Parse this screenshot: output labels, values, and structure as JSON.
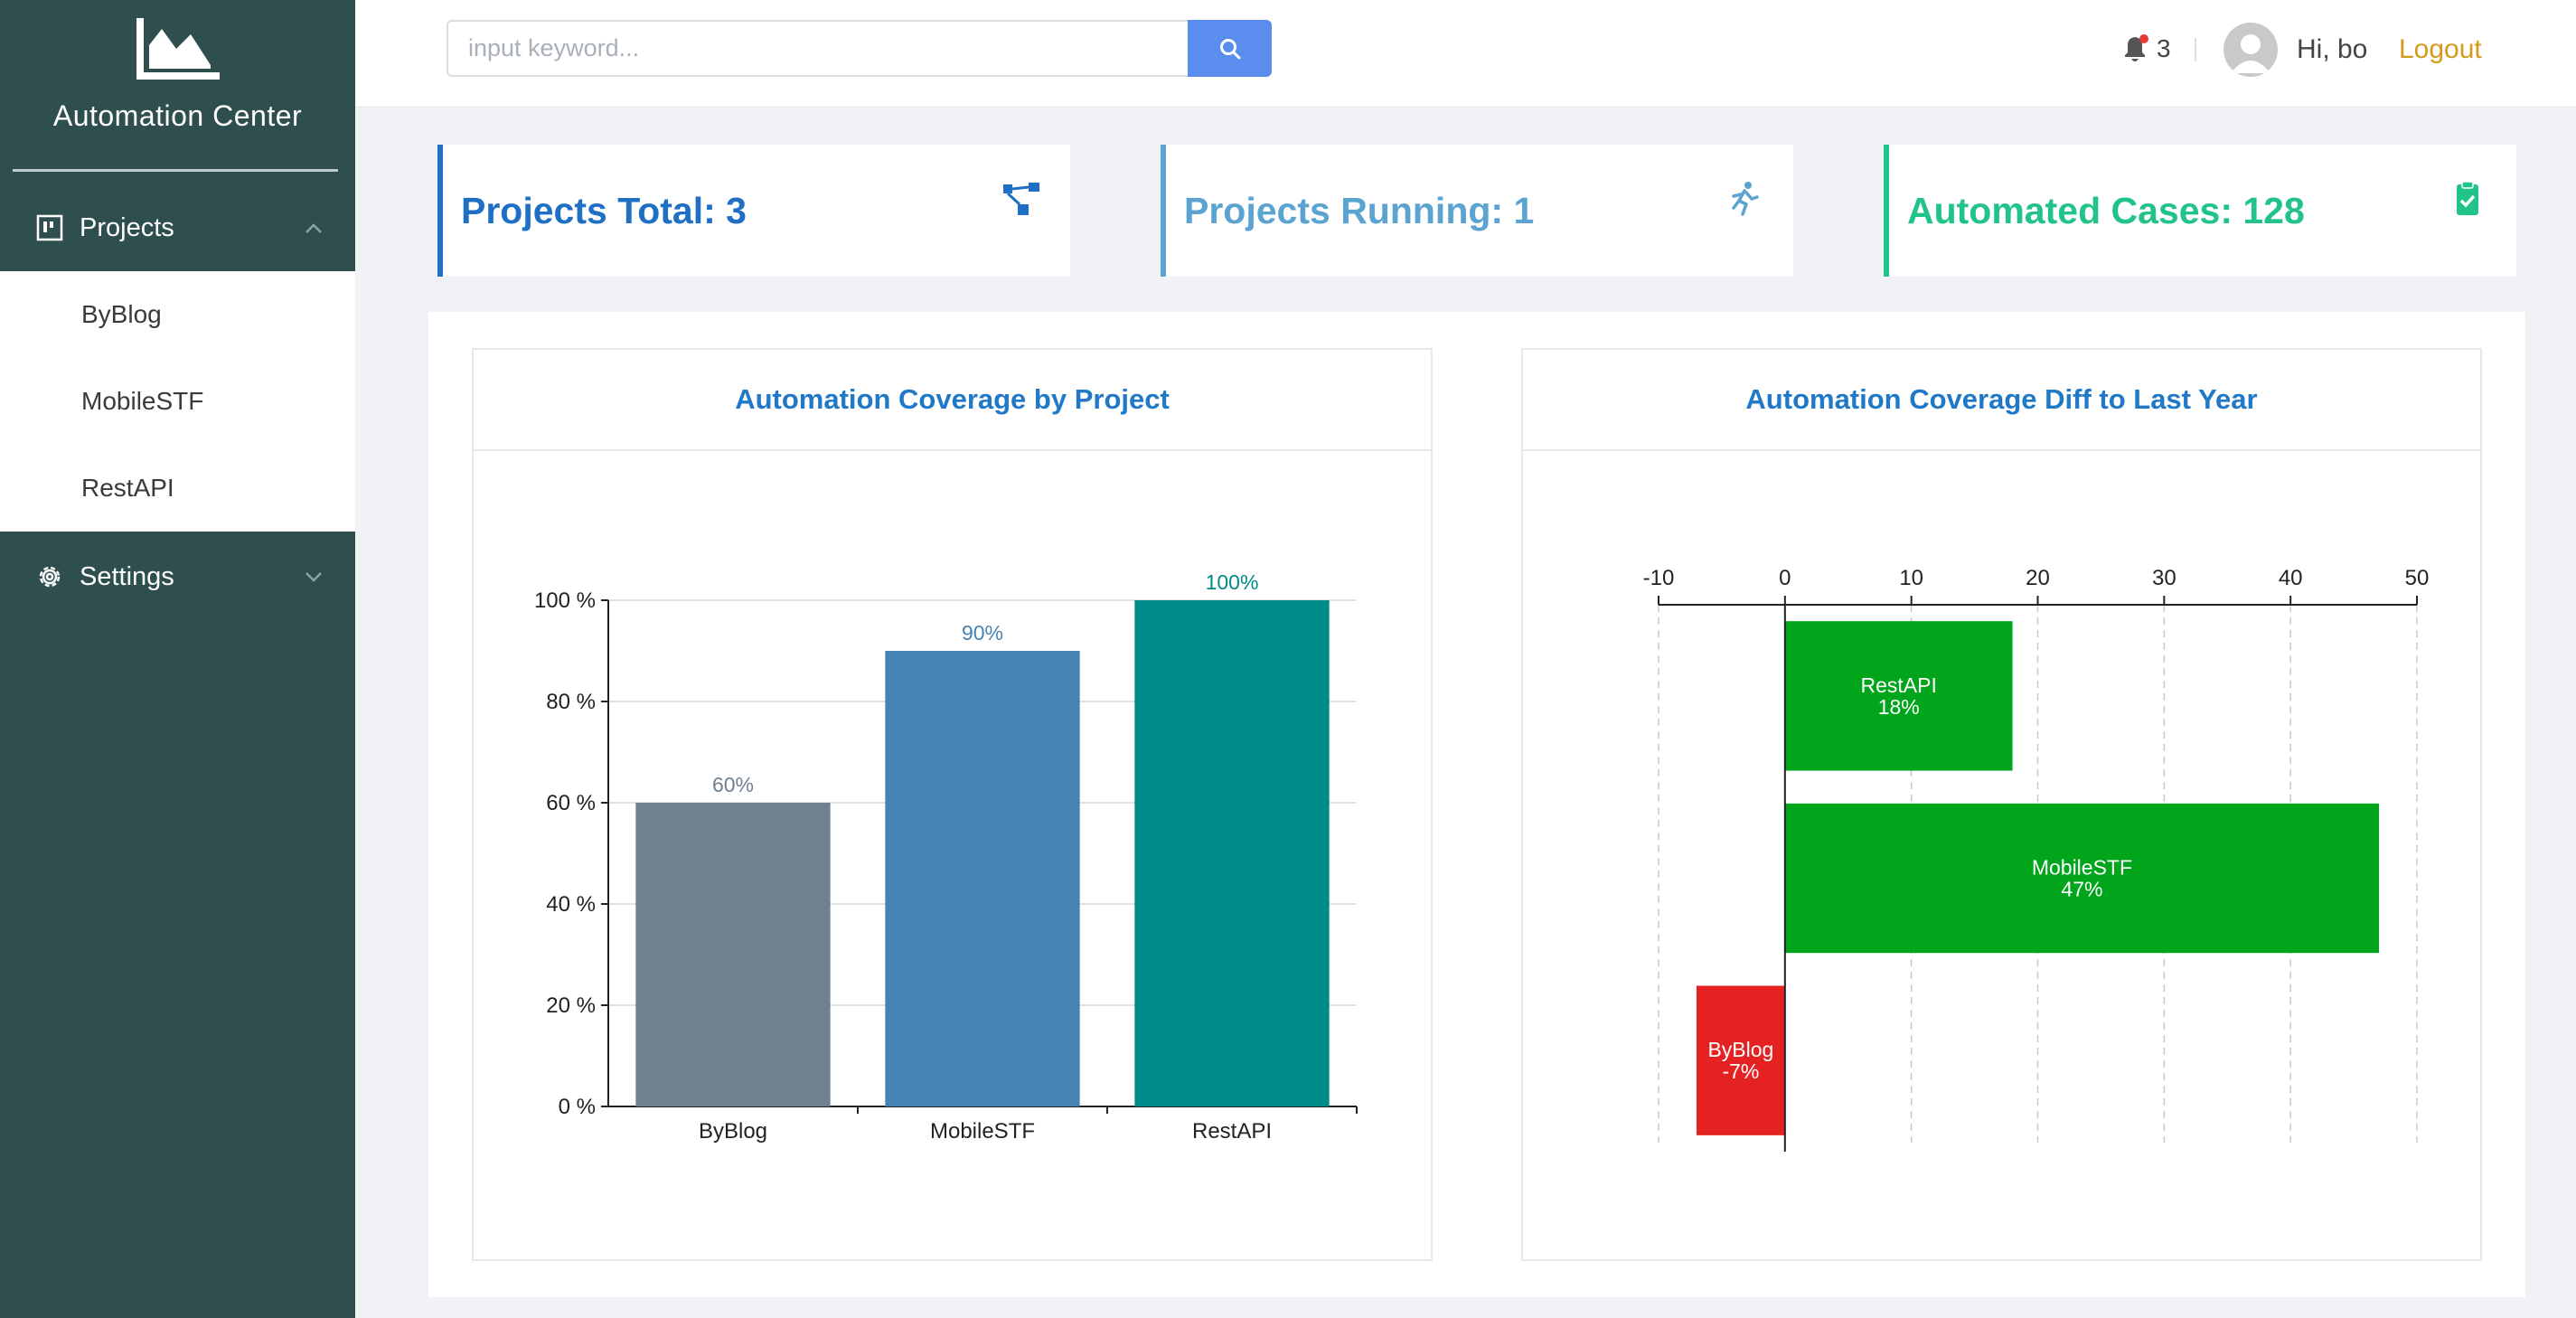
{
  "app": {
    "title": "Automation Center"
  },
  "sidebar": {
    "projects_label": "Projects",
    "projects_items": [
      {
        "label": "ByBlog"
      },
      {
        "label": "MobileSTF"
      },
      {
        "label": "RestAPI"
      }
    ],
    "settings_label": "Settings"
  },
  "header": {
    "search_placeholder": "input keyword...",
    "notification_count": "3",
    "greeting": "Hi, bo",
    "logout_label": "Logout"
  },
  "stats": [
    {
      "label": "Projects Total: 3",
      "color": "#1f6fc4",
      "icon": "project-tree-icon"
    },
    {
      "label": "Projects Running: 1",
      "color": "#5ba3d0",
      "icon": "running-person-icon"
    },
    {
      "label": "Automated Cases: 128",
      "color": "#21c389",
      "icon": "clipboard-check-icon"
    }
  ],
  "charts": {
    "coverage": {
      "title": "Automation Coverage by Project"
    },
    "diff": {
      "title": "Automation Coverage Diff to Last Year"
    }
  },
  "chart_data": [
    {
      "type": "bar",
      "title": "Automation Coverage by Project",
      "categories": [
        "ByBlog",
        "MobileSTF",
        "RestAPI"
      ],
      "values": [
        60,
        90,
        100
      ],
      "value_labels": [
        "60%",
        "90%",
        "100%"
      ],
      "colors": [
        "#708090",
        "#4682b4",
        "#008b8b"
      ],
      "ylim": [
        0,
        100
      ],
      "yticks": [
        0,
        20,
        40,
        60,
        80,
        100
      ],
      "ytick_labels": [
        "0 %",
        "20 %",
        "40 %",
        "60 %",
        "80 %",
        "100 %"
      ],
      "grid": true
    },
    {
      "type": "bar",
      "orientation": "horizontal",
      "title": "Automation Coverage Diff to Last Year",
      "categories": [
        "RestAPI",
        "MobileSTF",
        "ByBlog"
      ],
      "values": [
        18,
        47,
        -7
      ],
      "value_labels": [
        "18%",
        "47%",
        "-7%"
      ],
      "positive_color": "#00a51c",
      "negative_color": "#e52222",
      "xlim": [
        -10,
        50
      ],
      "xticks": [
        -10,
        0,
        10,
        20,
        30,
        40,
        50
      ],
      "axis_position": "top",
      "grid": "dashed"
    }
  ]
}
